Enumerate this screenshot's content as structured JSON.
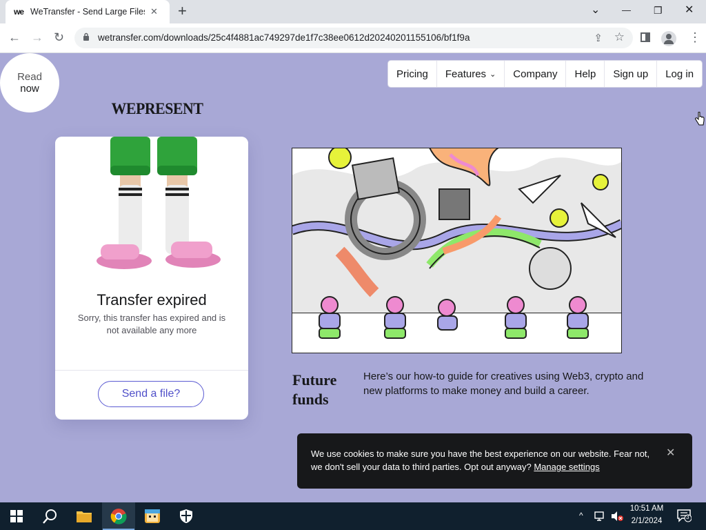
{
  "browser": {
    "tab": {
      "logo": "we",
      "title": "WeTransfer - Send Large Files & ",
      "close": "✕"
    },
    "new_tab": "+",
    "window": {
      "minimize": "—",
      "restore": "❐",
      "close": "✕",
      "tab_search": "⌄"
    },
    "url": "wetransfer.com/downloads/25c4f4881ac749297de1f7c38ee0612d20240201155106/bf1f9a",
    "nav": {
      "back": "←",
      "forward": "→",
      "reload": "↻"
    },
    "menu": "⋮"
  },
  "ad_circle": {
    "line1": "Read",
    "line2": "now"
  },
  "brand": "WEPRESENT",
  "topnav": {
    "items": [
      {
        "label": "Pricing"
      },
      {
        "label": "Features",
        "chevron": "⌄"
      },
      {
        "label": "Company"
      },
      {
        "label": "Help"
      },
      {
        "label": "Sign up"
      },
      {
        "label": "Log in"
      }
    ]
  },
  "card": {
    "title": "Transfer expired",
    "description": "Sorry, this transfer has expired and is not available any more",
    "button": "Send a file?"
  },
  "article": {
    "title": "Future funds",
    "description": "Here’s our how-to guide for creatives using Web3, crypto and new platforms to make money and build a career."
  },
  "cookie": {
    "text": "We use cookies to make sure you have the best experience on our website. Fear not, we don't sell your data to third parties. Opt out anyway?",
    "link": "Manage settings",
    "close": "✕"
  },
  "taskbar": {
    "time": "10:51 AM",
    "date": "2/1/2024",
    "notification_count": "3"
  }
}
